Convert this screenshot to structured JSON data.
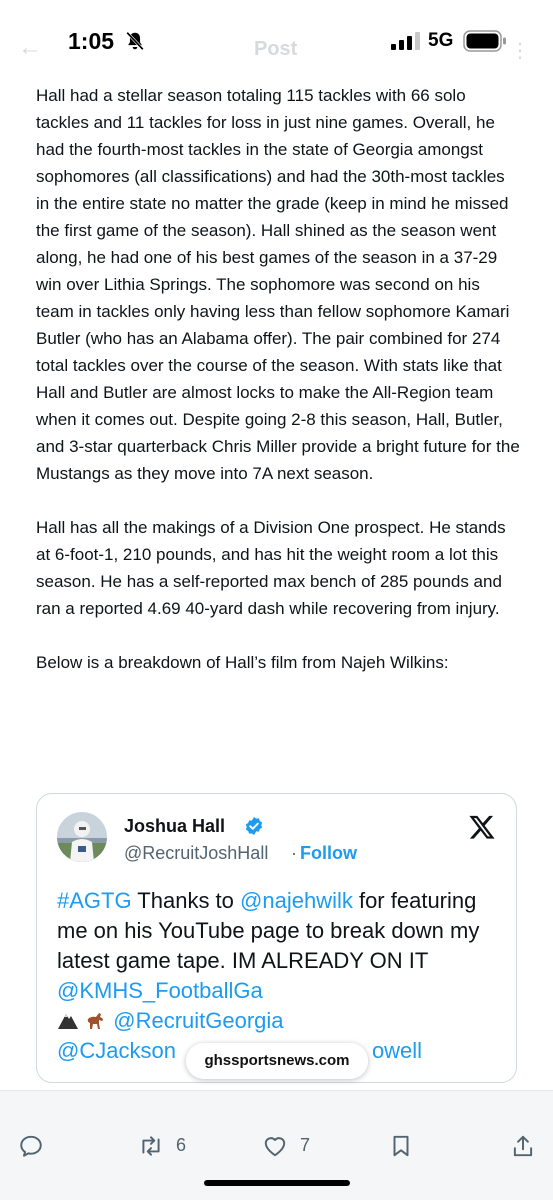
{
  "status": {
    "time": "1:05",
    "network": "5G",
    "icons": [
      "bell-muted-icon",
      "cellular-signal-icon",
      "battery-icon"
    ]
  },
  "header": {
    "back_icon": "back-arrow-icon",
    "title": "Post",
    "more_icon": "more-icon"
  },
  "article": {
    "paragraphs": [
      "Hall had a stellar season totaling 115 tackles with 66 solo tackles and 11 tackles for loss in just nine games. Overall, he had the fourth-most tackles in the state of Georgia amongst sophomores (all classifications) and had the 30th-most tackles in the entire state no matter the grade (keep in mind he missed the first game of the season). Hall shined as the season went along, he had one of his best games of the season in a 37-29 win over Lithia Springs. The sophomore was second on his team in tackles only having less than fellow sophomore Kamari Butler (who has an Alabama offer). The pair combined for 274 total tackles over the course of the season. With stats like that Hall and Butler are almost locks to make the All-Region team when it comes out. Despite going 2-8 this season, Hall, Butler, and 3-star quarterback Chris Miller provide a bright future for the Mustangs as they move into 7A next season.",
      "Hall has all the makings of a Division One prospect. He stands at 6-foot-1, 210 pounds, and has hit the weight room a lot this season. He has a self-reported max bench of 285 pounds and ran a reported 4.69 40-yard dash while recovering from injury.",
      "Below is a breakdown of Hall’s film from Najeh Wilkins:"
    ]
  },
  "embed": {
    "author_name": "Joshua Hall",
    "handle": "@RecruitJoshHall",
    "separator": "·",
    "follow_label": "Follow",
    "text_parts": {
      "hashtag": "#AGTG",
      "t1": " Thanks to ",
      "mention1": "@najehwilk",
      "t2": " for featuring me on his YouTube page to break down my latest game tape. IM ALREADY ON IT ",
      "mention2": "@KMHS_FootballGa",
      "mention3": "@RecruitGeorgia",
      "mention4": "@CJackson",
      "mention5": "owell"
    },
    "emoji_names": [
      "black-mountain-icon",
      "horse-icon"
    ]
  },
  "watermark": "ghssportsnews.com",
  "actions": {
    "reply_icon": "reply-icon",
    "repost_icon": "repost-icon",
    "repost_count": "6",
    "like_icon": "heart-icon",
    "like_count": "7",
    "bookmark_icon": "bookmark-icon",
    "share_icon": "share-icon"
  },
  "colors": {
    "link": "#1d9bf0",
    "text": "#0f1419",
    "muted": "#536471",
    "border": "#cfd9de"
  }
}
